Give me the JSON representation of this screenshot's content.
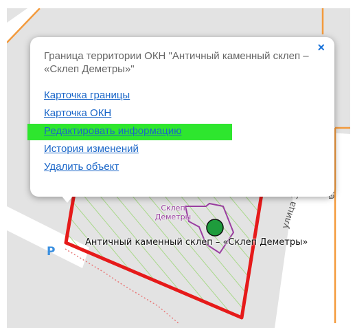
{
  "map": {
    "street_label": "ица",
    "street_label_2": "улица Зотьев П",
    "crypt_small_label": "Склеп\nДеметры",
    "object_label": "Античный каменный склеп – «Склеп Деметры»",
    "parking_symbol": "P",
    "colors": {
      "territory_border": "#e61a1a",
      "crypt_outline": "#9a3ea0",
      "object_marker": "#1e9c3c",
      "road_orange": "#f39a3c",
      "hatch": "#a8d88a",
      "parking": "#3a8fe0"
    }
  },
  "popup": {
    "close_icon": "×",
    "title": "Граница территории ОКН \"Античный каменный склеп – «Склеп Деметры»\"",
    "links": [
      {
        "label": "Карточка границы",
        "highlighted": false
      },
      {
        "label": "Карточка ОКН",
        "highlighted": false
      },
      {
        "label": "Редактировать информацию",
        "highlighted": true
      },
      {
        "label": "История изменений",
        "highlighted": false
      },
      {
        "label": "Удалить объект",
        "highlighted": false
      }
    ]
  }
}
